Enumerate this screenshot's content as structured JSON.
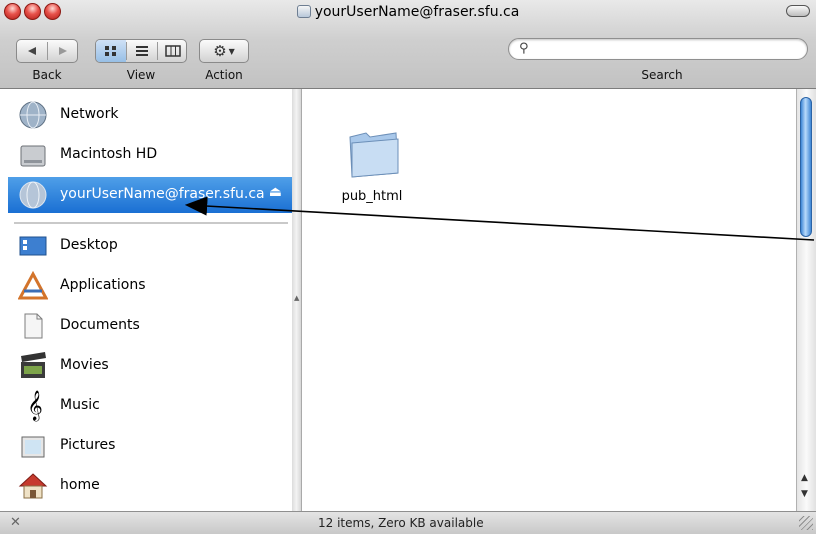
{
  "window": {
    "title": "yourUserName@fraser.sfu.ca"
  },
  "toolbar": {
    "back_label": "Back",
    "view_label": "View",
    "action_label": "Action",
    "search_label": "Search",
    "search_value": ""
  },
  "sidebar": {
    "items": [
      {
        "label": "Network",
        "icon": "network-globe-icon"
      },
      {
        "label": "Macintosh HD",
        "icon": "hard-drive-icon"
      },
      {
        "label": "yourUserName@fraser.sfu.ca",
        "icon": "server-volume-icon",
        "selected": true,
        "eject": "⏏"
      },
      {
        "label": "Desktop",
        "icon": "desktop-icon"
      },
      {
        "label": "Applications",
        "icon": "applications-icon"
      },
      {
        "label": "Documents",
        "icon": "documents-icon"
      },
      {
        "label": "Movies",
        "icon": "movies-icon"
      },
      {
        "label": "Music",
        "icon": "music-icon"
      },
      {
        "label": "Pictures",
        "icon": "pictures-icon"
      },
      {
        "label": "home",
        "icon": "home-icon"
      }
    ]
  },
  "content": {
    "items": [
      {
        "label": "pub_html",
        "icon": "folder-icon"
      }
    ]
  },
  "status": {
    "text": "12 items, Zero KB available"
  },
  "colors": {
    "selection": "#1a6fd3",
    "scroll_thumb": "#3f87d6"
  }
}
